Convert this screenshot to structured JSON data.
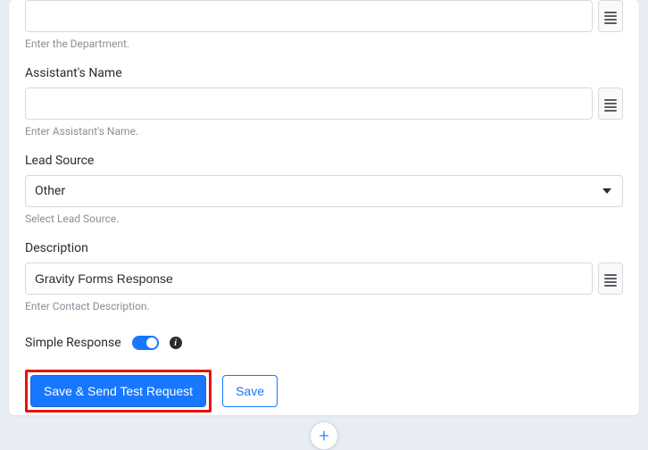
{
  "fields": {
    "department": {
      "value": "",
      "helper": "Enter the Department."
    },
    "assistantName": {
      "label": "Assistant's Name",
      "value": "",
      "helper": "Enter Assistant's Name."
    },
    "leadSource": {
      "label": "Lead Source",
      "selected": "Other",
      "helper": "Select Lead Source."
    },
    "description": {
      "label": "Description",
      "value": "Gravity Forms Response",
      "helper": "Enter Contact Description."
    }
  },
  "simpleResponse": {
    "label": "Simple Response",
    "enabled": true
  },
  "buttons": {
    "saveSendTest": "Save & Send Test Request",
    "save": "Save"
  }
}
